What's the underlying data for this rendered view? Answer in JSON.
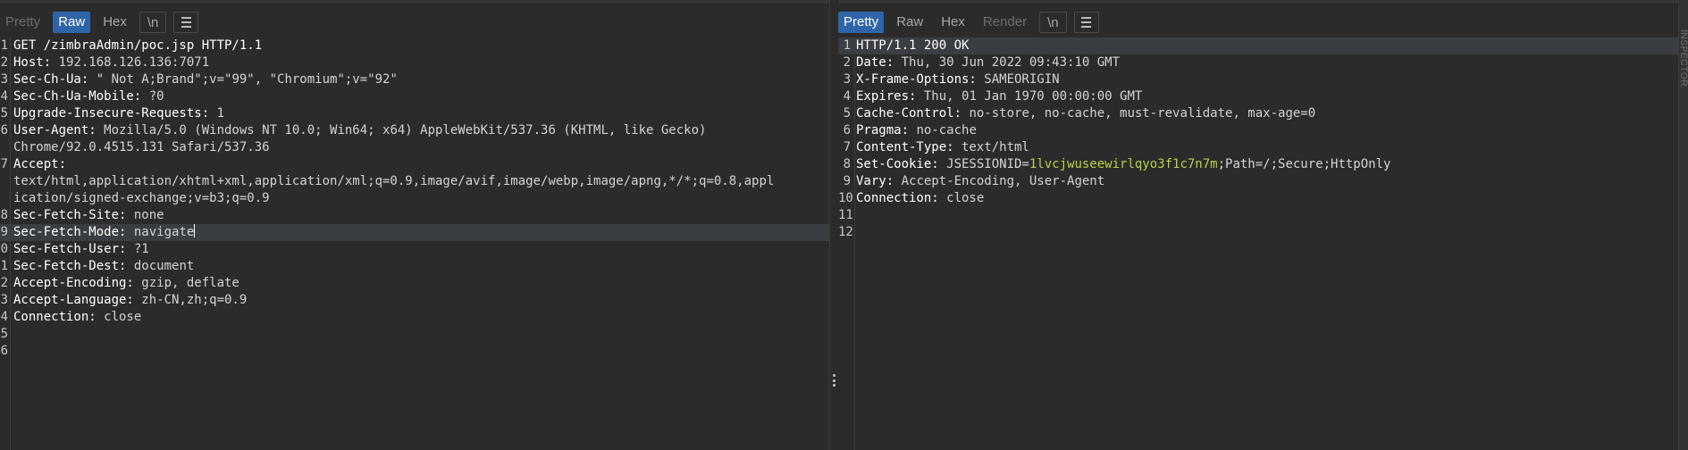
{
  "request": {
    "tabs": [
      {
        "label": "Pretty",
        "state": "dim"
      },
      {
        "label": "Raw",
        "state": "active"
      },
      {
        "label": "Hex",
        "state": "normal"
      },
      {
        "label": "\\n",
        "state": "boxed"
      }
    ],
    "lines": [
      {
        "num": "1",
        "name": "GET /zimbraAdmin/poc.jsp HTTP/1.1",
        "value": ""
      },
      {
        "num": "2",
        "name": "Host:",
        "value": " 192.168.126.136:7071"
      },
      {
        "num": "3",
        "name": "Sec-Ch-Ua:",
        "value": " \" Not A;Brand\";v=\"99\", \"Chromium\";v=\"92\""
      },
      {
        "num": "4",
        "name": "Sec-Ch-Ua-Mobile:",
        "value": " ?0"
      },
      {
        "num": "5",
        "name": "Upgrade-Insecure-Requests:",
        "value": " 1"
      },
      {
        "num": "6",
        "name": "User-Agent:",
        "value": " Mozilla/5.0 (Windows NT 10.0; Win64; x64) AppleWebKit/537.36 (KHTML, like Gecko)"
      },
      {
        "num": "",
        "name": "",
        "value": "Chrome/92.0.4515.131 Safari/537.36"
      },
      {
        "num": "7",
        "name": "Accept:",
        "value": ""
      },
      {
        "num": "",
        "name": "",
        "value": "text/html,application/xhtml+xml,application/xml;q=0.9,image/avif,image/webp,image/apng,*/*;q=0.8,appl"
      },
      {
        "num": "",
        "name": "",
        "value": "ication/signed-exchange;v=b3;q=0.9"
      },
      {
        "num": "8",
        "name": "Sec-Fetch-Site:",
        "value": " none"
      },
      {
        "num": "9",
        "name": "Sec-Fetch-Mode:",
        "value": " navigate"
      },
      {
        "num": "0",
        "name": "Sec-Fetch-User:",
        "value": " ?1"
      },
      {
        "num": "1",
        "name": "Sec-Fetch-Dest:",
        "value": " document"
      },
      {
        "num": "2",
        "name": "Accept-Encoding:",
        "value": " gzip, deflate"
      },
      {
        "num": "3",
        "name": "Accept-Language:",
        "value": " zh-CN,zh;q=0.9"
      },
      {
        "num": "4",
        "name": "Connection:",
        "value": " close"
      },
      {
        "num": "5",
        "name": "",
        "value": ""
      },
      {
        "num": "6",
        "name": "",
        "value": ""
      }
    ]
  },
  "response": {
    "tabs": [
      {
        "label": "Pretty",
        "state": "active"
      },
      {
        "label": "Raw",
        "state": "normal"
      },
      {
        "label": "Hex",
        "state": "normal"
      },
      {
        "label": "Render",
        "state": "dim"
      },
      {
        "label": "\\n",
        "state": "boxed"
      }
    ],
    "lines": [
      {
        "num": "1",
        "name": "HTTP/1.1 200 OK",
        "value": ""
      },
      {
        "num": "2",
        "name": "Date:",
        "value": " Thu, 30 Jun 2022 09:43:10 GMT"
      },
      {
        "num": "3",
        "name": "X-Frame-Options:",
        "value": " SAMEORIGIN"
      },
      {
        "num": "4",
        "name": "Expires:",
        "value": " Thu, 01 Jan 1970 00:00:00 GMT"
      },
      {
        "num": "5",
        "name": "Cache-Control:",
        "value": " no-store, no-cache, must-revalidate, max-age=0"
      },
      {
        "num": "6",
        "name": "Pragma:",
        "value": " no-cache"
      },
      {
        "num": "7",
        "name": "Content-Type:",
        "value": " text/html"
      },
      {
        "num": "8",
        "name": "Set-Cookie:",
        "value": " JSESSIONID=",
        "cookie": "1lvcjwuseewirlqyo3f1c7n7m",
        "suffix": ";Path=/;Secure;HttpOnly"
      },
      {
        "num": "9",
        "name": "Vary:",
        "value": " Accept-Encoding, User-Agent"
      },
      {
        "num": "10",
        "name": "Connection:",
        "value": " close"
      },
      {
        "num": "11",
        "name": "",
        "value": ""
      },
      {
        "num": "12",
        "name": "",
        "value": ""
      }
    ]
  },
  "side_panel": {
    "label": "INSPECTOR"
  },
  "icons": {
    "menu": "hamburger-menu-icon",
    "divider_grip": "drag-handle-icon"
  },
  "colors": {
    "background": "#2b2b2b",
    "active_tab": "#2f65a8",
    "cookie_value": "#b5d34a"
  }
}
